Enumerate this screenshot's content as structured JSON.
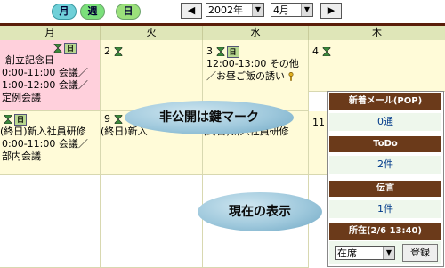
{
  "view_tabs": {
    "month": "月",
    "week": "週",
    "day": "日"
  },
  "nav": {
    "prev": "◀",
    "next": "▶",
    "year": "2002年",
    "month": "4月"
  },
  "headers": [
    "月",
    "火",
    "水",
    "木"
  ],
  "cells": {
    "r1c1": {
      "lines": [
        "創立記念日",
        "0:00-11:00 会議／",
        "1:00-12:00 会議／",
        "定例会議"
      ]
    },
    "r1c2": {
      "num": "2"
    },
    "r1c3": {
      "num": "3",
      "lines": [
        "12:00-13:00 その他",
        "／お昼ご飯の誘い"
      ]
    },
    "r1c4": {
      "num": "4"
    },
    "r2c1": {
      "lines": [
        "(終日)新入社員研修",
        "0:00-11:00 会議／",
        "部内会議"
      ]
    },
    "r2c2": {
      "num": "9",
      "lines": [
        "(終日)新入"
      ]
    },
    "r2c3": {
      "lines": [
        "(終日)新入社員研修"
      ]
    },
    "r2c4": {
      "num": "11"
    }
  },
  "callouts": {
    "private": "非公開は鍵マーク",
    "current": "現在の表示"
  },
  "panel": {
    "mail_title": "新着メール(POP)",
    "mail_value": "0通",
    "todo_title": "ToDo",
    "todo_value": "2件",
    "msg_title": "伝言",
    "msg_value": "1件",
    "status_title": "所在(2/6 13:40)",
    "status_select": "在席",
    "register": "登録"
  },
  "colors": {
    "accent_brown": "#6b3a1a",
    "cell_yellow": "#fffbd8",
    "cell_pink": "#ffd0dc"
  }
}
